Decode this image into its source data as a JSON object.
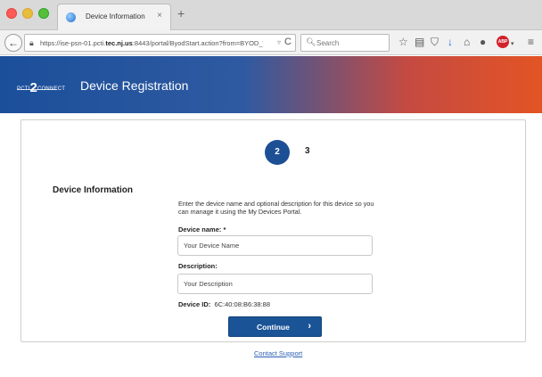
{
  "browser": {
    "tab_title": "Device Information",
    "tab_close": "×",
    "new_tab": "+",
    "back": "←",
    "url_prefix": "https://ise-psn-01.pcti.",
    "url_domain": "tec.nj.us",
    "url_suffix": ":8443/portal/ByodStart.action?from=BYOD_WEL",
    "url_dropdown": "▿",
    "reload": "C",
    "search_placeholder": "Search",
    "toolbar_icons": [
      "star-icon",
      "reading-list-icon",
      "pocket-icon",
      "download-icon",
      "home-icon",
      "chat-icon",
      "adblock-icon",
      "menu-icon"
    ],
    "adblock_text": "ABP"
  },
  "header": {
    "logo_prefix": "PCTI",
    "logo_number": "2",
    "logo_suffix": "CONNECT",
    "title": "Device Registration"
  },
  "steps": {
    "current": "2",
    "next": "3"
  },
  "form": {
    "section_label": "Device Information",
    "intro": "Enter the device name and optional description for this device so you can manage it using the My Devices Portal.",
    "name_label": "Device name: *",
    "name_value": "Your Device Name",
    "description_label": "Description:",
    "description_value": "Your Description",
    "device_id_label": "Device ID:",
    "device_id_value": "6C:40:08:B6:38:88",
    "continue_label": "Continue",
    "continue_arrow": "›"
  },
  "footer": {
    "support_link": "Contact Support"
  },
  "colors": {
    "brand_blue": "#1a5396",
    "banner_start": "#1b4f9a",
    "banner_end": "#e35424",
    "link": "#2a5fb3"
  }
}
